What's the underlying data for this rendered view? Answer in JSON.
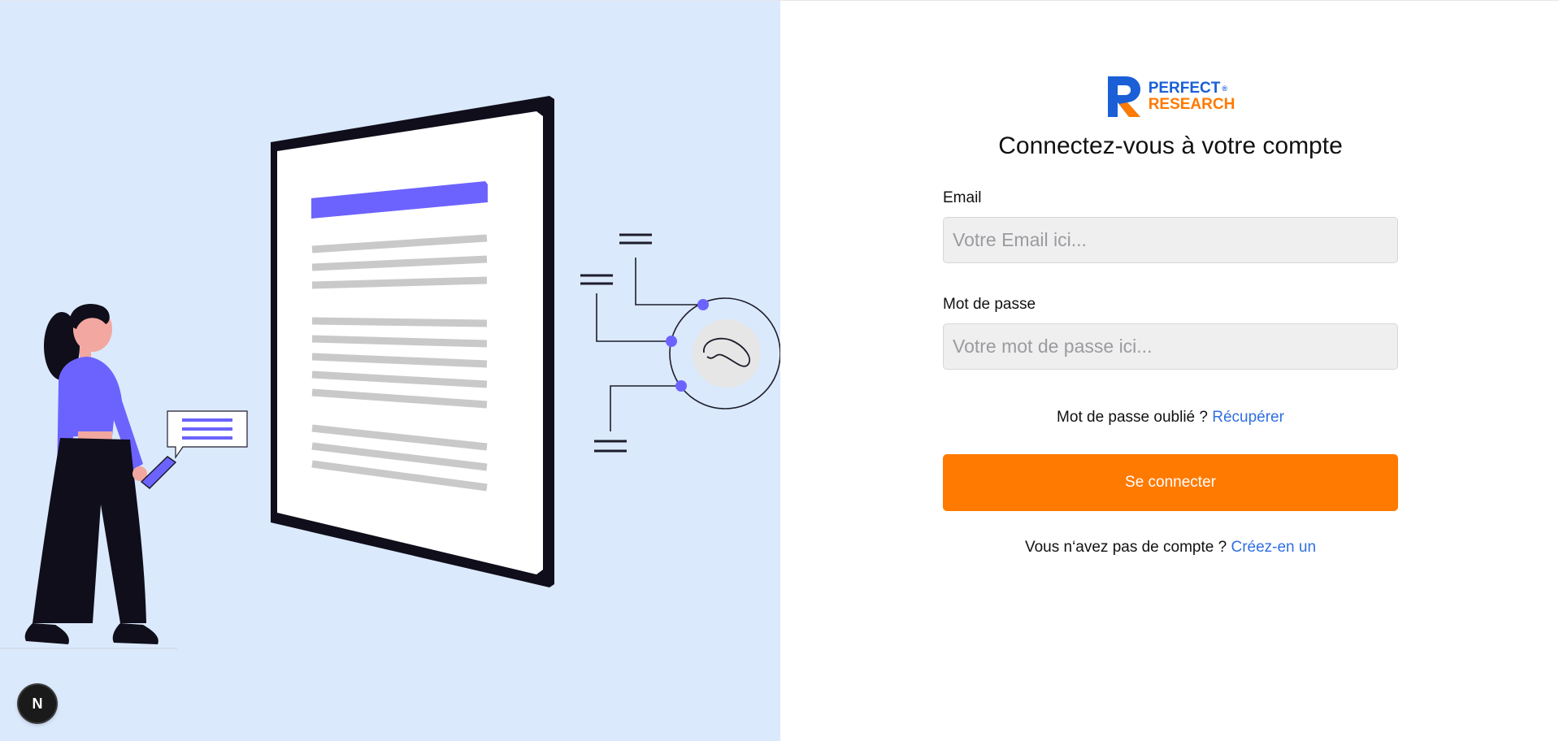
{
  "brand": {
    "line1": "PERFECT",
    "registered_mark": "®",
    "line2": "RESEARCH",
    "primary_color": "#1a5fd6",
    "accent_color": "#ff7a00"
  },
  "login_form": {
    "heading": "Connectez-vous à votre compte",
    "email_label": "Email",
    "email_placeholder": "Votre Email ici...",
    "email_value": "",
    "password_label": "Mot de passe",
    "password_placeholder": "Votre mot de passe ici...",
    "password_value": "",
    "forgot_text": "Mot de passe oublié ?",
    "forgot_link": "Récupérer",
    "submit_label": "Se connecter",
    "signup_text": "Vous n‘avez pas de compte ?",
    "signup_link": "Créez-en un"
  },
  "dev_badge": {
    "label": "N"
  },
  "illustration": {
    "background_color": "#dbe9fd",
    "accent_color": "#6c63ff",
    "icons": [
      "document-icon",
      "fingerprint-icon",
      "person-with-phone-icon",
      "chat-bubble-icon"
    ]
  }
}
